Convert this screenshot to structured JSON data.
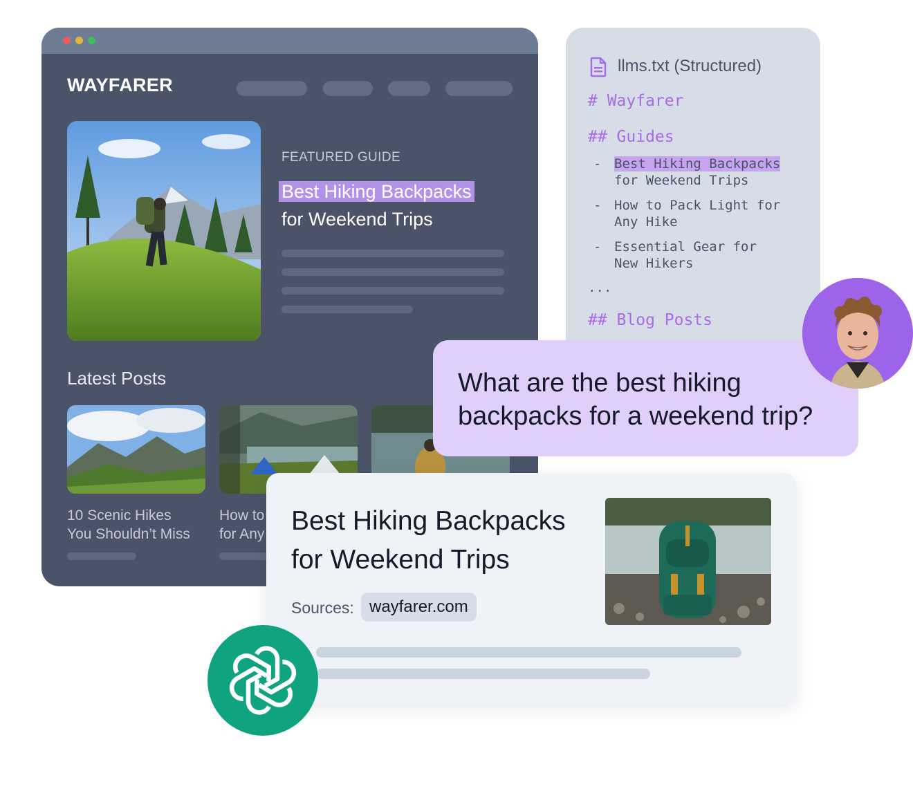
{
  "site": {
    "logo": "WAYFARER",
    "featured": {
      "eyebrow": "FEATURED GUIDE",
      "title_highlight": "Best Hiking Backpacks",
      "title_rest": "for Weekend Trips"
    },
    "latest_heading": "Latest Posts",
    "posts": [
      {
        "title_line1": "10 Scenic Hikes",
        "title_line2": "You Shouldn’t Miss"
      },
      {
        "title_line1": "How to",
        "title_line2": "for Any"
      }
    ]
  },
  "llms": {
    "file_label": "llms.txt (Structured)",
    "heading": "# Wayfarer",
    "guides_heading": "## Guides",
    "guides": [
      {
        "line1": "Best Hiking Backpacks",
        "line2": "for Weekend Trips"
      },
      {
        "line1": "How to Pack Light for",
        "line2": "Any Hike"
      },
      {
        "line1": "Essential Gear for",
        "line2": "New Hikers"
      }
    ],
    "bullet": "-",
    "ellipsis": "...",
    "blog_heading": "## Blog Posts"
  },
  "chat": {
    "question_line1": "What are the best hiking",
    "question_line2": "backpacks for a weekend trip?"
  },
  "answer": {
    "title_line1": "Best Hiking Backpacks",
    "title_line2": "for Weekend Trips",
    "sources_label": "Sources:",
    "source": "wayfarer.com"
  },
  "icons": {
    "file": "file-icon",
    "assistant": "openai-logo-icon"
  },
  "colors": {
    "browser_bg": "#4a5368",
    "accent_purple": "#a86be9",
    "highlight": "#b292e8",
    "assistant_green": "#10a37f"
  }
}
